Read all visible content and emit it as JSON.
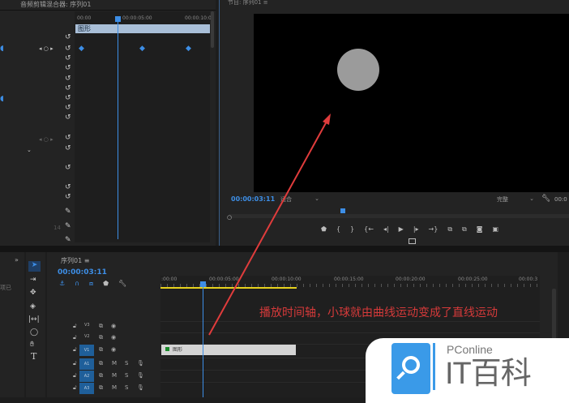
{
  "effect_controls": {
    "tab_title": "音频剪辑混合器: 序列01",
    "ruler": [
      "00:00",
      "00:00:05:00",
      "00:00:10:0"
    ],
    "clip_label": "图形",
    "value_partial": "14"
  },
  "program_monitor": {
    "title": "节目: 序列01 ≡",
    "timecode": "00:00:03:11",
    "zoom_select": "适合",
    "quality_select": "完整",
    "duration_partial": "00:0"
  },
  "project_panel": {
    "text": "项已"
  },
  "timeline": {
    "title": "序列01 ≡",
    "timecode": "00:00:03:11",
    "ruler": [
      ":00:00",
      "00:00:05:00",
      "00:00:10:00",
      "00:00:15:00",
      "00:00:20:00",
      "00:00:25:00",
      "00:00:3"
    ],
    "tracks": [
      {
        "name": "V3",
        "type": "video"
      },
      {
        "name": "V2",
        "type": "video"
      },
      {
        "name": "V1",
        "type": "video"
      },
      {
        "name": "A1",
        "type": "audio"
      },
      {
        "name": "A2",
        "type": "audio"
      },
      {
        "name": "A3",
        "type": "audio"
      }
    ],
    "mute_label": "M",
    "solo_label": "S",
    "clip_label": "图形"
  },
  "annotation": {
    "text": "播放时间轴，小球就由曲线运动变成了直线运动",
    "color": "#d63a3a"
  },
  "watermark": {
    "brand": "PConline",
    "name": "IT百科",
    "color": "#3a9ae8"
  },
  "colors": {
    "accent": "#3d8ee6",
    "work_area": "#e6d21e",
    "ball": "#9b9b9b"
  }
}
